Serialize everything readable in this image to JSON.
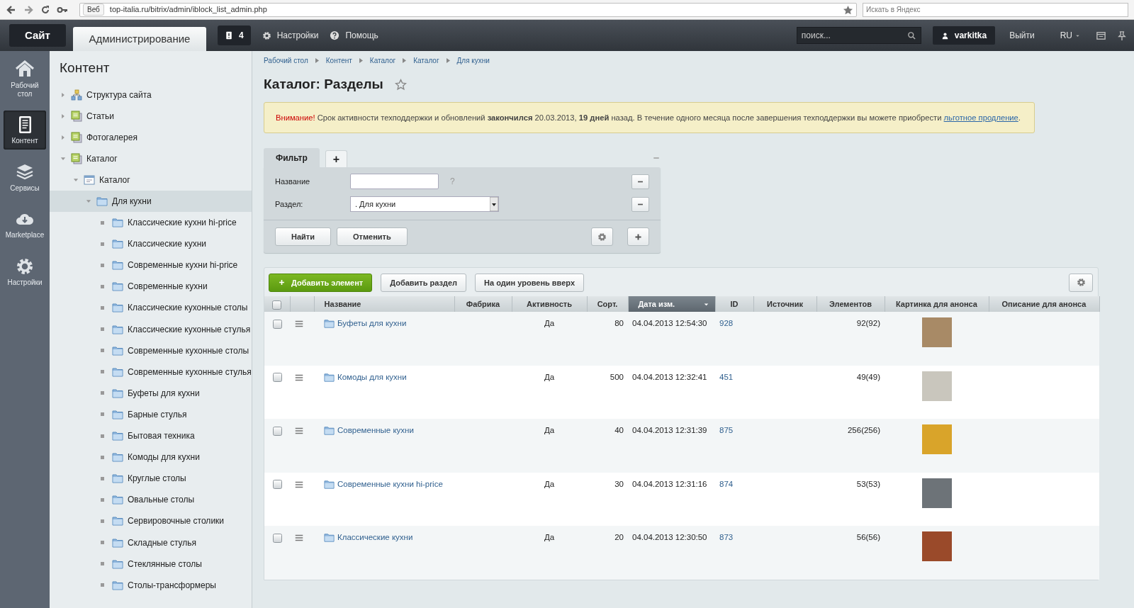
{
  "browser": {
    "site_badge": "Веб",
    "url": "top-italia.ru/bitrix/admin/iblock_list_admin.php",
    "search_placeholder": "Искать в Яндекс"
  },
  "header": {
    "tabs": [
      {
        "label": "Сайт",
        "selected": false
      },
      {
        "label": "Администрирование",
        "selected": true
      }
    ],
    "notifications": "4",
    "settings": "Настройки",
    "help": "Помощь",
    "search_placeholder": "поиск...",
    "user": "varkitka",
    "logout": "Выйти",
    "language": "RU"
  },
  "side_menu": [
    {
      "label": "Рабочий стол",
      "kind": "home",
      "selected": false
    },
    {
      "label": "Контент",
      "kind": "content",
      "selected": true
    },
    {
      "label": "Сервисы",
      "kind": "services",
      "selected": false
    },
    {
      "label": "Marketplace",
      "kind": "marketplace",
      "selected": false
    },
    {
      "label": "Настройки",
      "kind": "settings",
      "selected": false
    }
  ],
  "tree": {
    "title": "Контент",
    "items": [
      {
        "label": "Структура сайта",
        "kind": "structure",
        "expanded": false,
        "selected": false
      },
      {
        "label": "Статьи",
        "kind": "block",
        "expanded": false,
        "selected": false
      },
      {
        "label": "Фотогалерея",
        "kind": "block",
        "expanded": false,
        "selected": false
      },
      {
        "label": "Каталог",
        "kind": "block",
        "expanded": true,
        "selected": false,
        "children": [
          {
            "label": "Каталог",
            "kind": "catalog",
            "expanded": true,
            "selected": false,
            "children": [
              {
                "label": "Для кухни",
                "kind": "folder",
                "expanded": true,
                "selected": true,
                "children": [
                  {
                    "label": "Классические кухни hi-price",
                    "kind": "folder",
                    "selected": false
                  },
                  {
                    "label": "Классические кухни",
                    "kind": "folder",
                    "selected": false
                  },
                  {
                    "label": "Современные кухни hi-price",
                    "kind": "folder",
                    "selected": false
                  },
                  {
                    "label": "Современные кухни",
                    "kind": "folder",
                    "selected": false
                  },
                  {
                    "label": "Классические кухонные столы",
                    "kind": "folder",
                    "selected": false
                  },
                  {
                    "label": "Классические кухонные стулья",
                    "kind": "folder",
                    "selected": false
                  },
                  {
                    "label": "Современные кухонные столы",
                    "kind": "folder",
                    "selected": false
                  },
                  {
                    "label": "Современные кухонные стулья",
                    "kind": "folder",
                    "selected": false
                  },
                  {
                    "label": "Буфеты для кухни",
                    "kind": "folder",
                    "selected": false
                  },
                  {
                    "label": "Барные стулья",
                    "kind": "folder",
                    "selected": false
                  },
                  {
                    "label": "Бытовая техника",
                    "kind": "folder",
                    "selected": false
                  },
                  {
                    "label": "Комоды для кухни",
                    "kind": "folder",
                    "selected": false
                  },
                  {
                    "label": "Круглые столы",
                    "kind": "folder",
                    "selected": false
                  },
                  {
                    "label": "Овальные столы",
                    "kind": "folder",
                    "selected": false
                  },
                  {
                    "label": "Сервировочные столики",
                    "kind": "folder",
                    "selected": false
                  },
                  {
                    "label": "Складные стулья",
                    "kind": "folder",
                    "selected": false
                  },
                  {
                    "label": "Стеклянные столы",
                    "kind": "folder",
                    "selected": false
                  },
                  {
                    "label": "Столы-трансформеры",
                    "kind": "folder",
                    "selected": false
                  }
                ]
              }
            ]
          }
        ]
      }
    ]
  },
  "breadcrumbs": [
    "Рабочий стол",
    "Контент",
    "Каталог",
    "Каталог",
    "Для кухни"
  ],
  "page_title": "Каталог: Разделы",
  "warning": {
    "label": "Внимание!",
    "text": "Срок активности техподдержки и обновлений **закончился** 20.03.2013, **19 дней** назад. В течение одного месяца после завершения техподдержки вы можете приобрести",
    "link": "льготное продление",
    "tail": "."
  },
  "filter": {
    "tabs": [
      {
        "label": "Фильтр",
        "selected": true
      },
      {
        "label": "+",
        "selected": false
      }
    ],
    "fields": [
      {
        "label": "Название",
        "kind": "text",
        "hint": "?"
      },
      {
        "label": "Раздел:",
        "kind": "select",
        "value": ". Для кухни"
      }
    ],
    "buttons": [
      "Найти",
      "Отменить"
    ]
  },
  "toolbar": [
    {
      "label": "Добавить элемент",
      "kind": "primary"
    },
    {
      "label": "Добавить раздел",
      "kind": "default"
    },
    {
      "label": "На один уровень вверх",
      "kind": "default"
    }
  ],
  "table": {
    "select_all_checked": false,
    "columns": [
      {
        "label": "Название",
        "sorted": false
      },
      {
        "label": "Фабрика",
        "sorted": false
      },
      {
        "label": "Активность",
        "sorted": false
      },
      {
        "label": "Сорт.",
        "sorted": false
      },
      {
        "label": "Дата изм.",
        "sorted": true
      },
      {
        "label": "ID",
        "sorted": false
      },
      {
        "label": "Источник",
        "sorted": false
      },
      {
        "label": "Элементов",
        "sorted": false
      },
      {
        "label": "Картинка для анонса",
        "sorted": false
      },
      {
        "label": "Описание для анонса",
        "sorted": false
      }
    ],
    "rows": [
      {
        "checked": false,
        "name": "Буфеты для кухни",
        "active": "Да",
        "sort": "80",
        "date": "04.04.2013 12:54:30",
        "id": "928",
        "elements": "92(92)"
      },
      {
        "checked": false,
        "name": "Комоды для кухни",
        "active": "Да",
        "sort": "500",
        "date": "04.04.2013 12:32:41",
        "id": "451",
        "elements": "49(49)"
      },
      {
        "checked": false,
        "name": "Современные кухни",
        "active": "Да",
        "sort": "40",
        "date": "04.04.2013 12:31:39",
        "id": "875",
        "elements": "256(256)"
      },
      {
        "checked": false,
        "name": "Современные кухни hi-price",
        "active": "Да",
        "sort": "30",
        "date": "04.04.2013 12:31:16",
        "id": "874",
        "elements": "53(53)"
      },
      {
        "checked": false,
        "name": "Классические кухни",
        "active": "Да",
        "sort": "20",
        "date": "04.04.2013 12:30:50",
        "id": "873",
        "elements": "56(56)"
      }
    ]
  }
}
